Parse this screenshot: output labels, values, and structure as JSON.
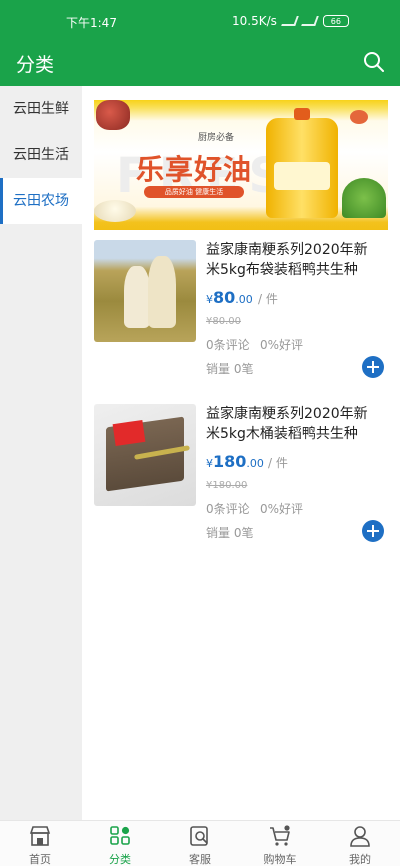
{
  "status_bar": {
    "time": "下午1:47",
    "network": "10.5K/s",
    "battery": "66"
  },
  "header": {
    "title": "分类",
    "search_icon": "search-icon"
  },
  "sidebar": {
    "items": [
      {
        "label": "云田生鲜",
        "active": false
      },
      {
        "label": "云田生活",
        "active": false
      },
      {
        "label": "云田农场",
        "active": true
      }
    ]
  },
  "banner": {
    "top_text": "厨房必备",
    "headline": "乐享好油",
    "tag_text": "品质好油 健康生活",
    "watermark": "FRESH"
  },
  "products": [
    {
      "title": "益家康南粳系列2020年新米5kg布袋装稻鸭共生种植...",
      "price_currency": "¥",
      "price_int": "80",
      "price_dec": ".00",
      "unit": "/ 件",
      "old_price": "¥80.00",
      "reviews": "0条评论",
      "good_rate": "0%好评",
      "sales": "销量 0笔"
    },
    {
      "title": "益家康南粳系列2020年新米5kg木桶装稻鸭共生种植...",
      "price_currency": "¥",
      "price_int": "180",
      "price_dec": ".00",
      "unit": "/ 件",
      "old_price": "¥180.00",
      "reviews": "0条评论",
      "good_rate": "0%好评",
      "sales": "销量 0笔"
    }
  ],
  "tabbar": {
    "items": [
      {
        "label": "首页",
        "icon": "store-icon",
        "active": false
      },
      {
        "label": "分类",
        "icon": "category-grid-icon",
        "active": true
      },
      {
        "label": "客服",
        "icon": "customer-service-icon",
        "active": false
      },
      {
        "label": "购物车",
        "icon": "cart-icon",
        "active": false
      },
      {
        "label": "我的",
        "icon": "user-icon",
        "active": false
      }
    ]
  },
  "colors": {
    "brand_green": "#1aa34a",
    "accent_blue": "#1e6fc4",
    "banner_red": "#e0532a"
  }
}
